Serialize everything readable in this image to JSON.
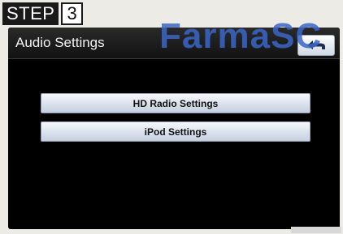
{
  "step": {
    "word": "STEP",
    "number": "3"
  },
  "watermark": "FarmaSC",
  "screen": {
    "title": "Audio Settings",
    "back_icon": "return-arrow-icon",
    "menu": [
      {
        "label": "HD Radio Settings"
      },
      {
        "label": "iPod Settings"
      }
    ]
  },
  "colors": {
    "screen_background": "#000000",
    "button_gradient_top": "#f6f8fc",
    "button_gradient_bottom": "#c3cfe0",
    "watermark": "#3a66c9"
  }
}
